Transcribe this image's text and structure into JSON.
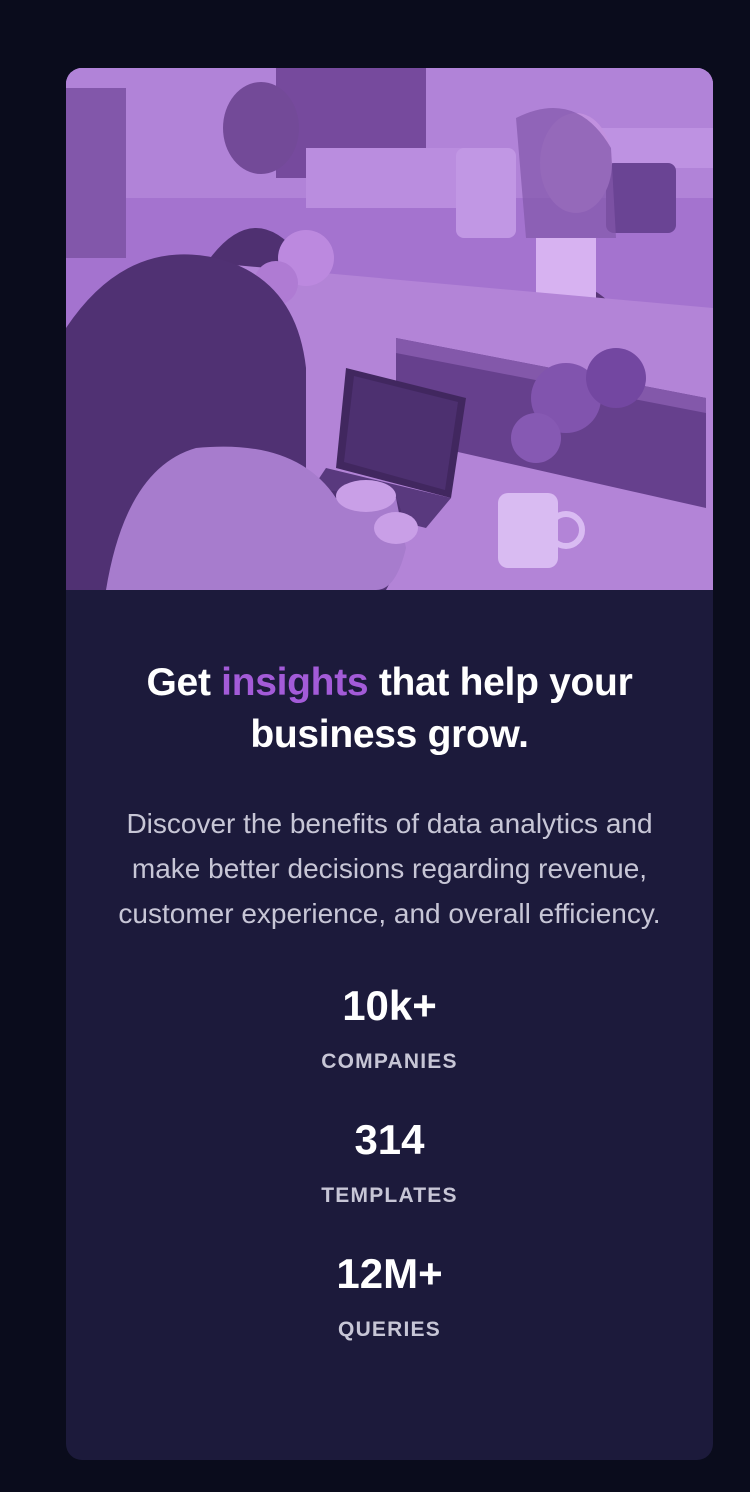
{
  "headline": {
    "prefix": "Get ",
    "accent": "insights",
    "suffix": " that help your business grow."
  },
  "description": "Discover the benefits of data analytics and make better decisions regarding revenue, customer experience, and overall efficiency.",
  "stats": [
    {
      "value": "10k+",
      "label": "COMPANIES"
    },
    {
      "value": "314",
      "label": "TEMPLATES"
    },
    {
      "value": "12M+",
      "label": "QUERIES"
    }
  ],
  "colors": {
    "page_background": "#0a0c1c",
    "card_background": "#1c1a3b",
    "accent": "#a35bd8",
    "heading": "#ffffff",
    "body_text": "#c7c6d6"
  }
}
